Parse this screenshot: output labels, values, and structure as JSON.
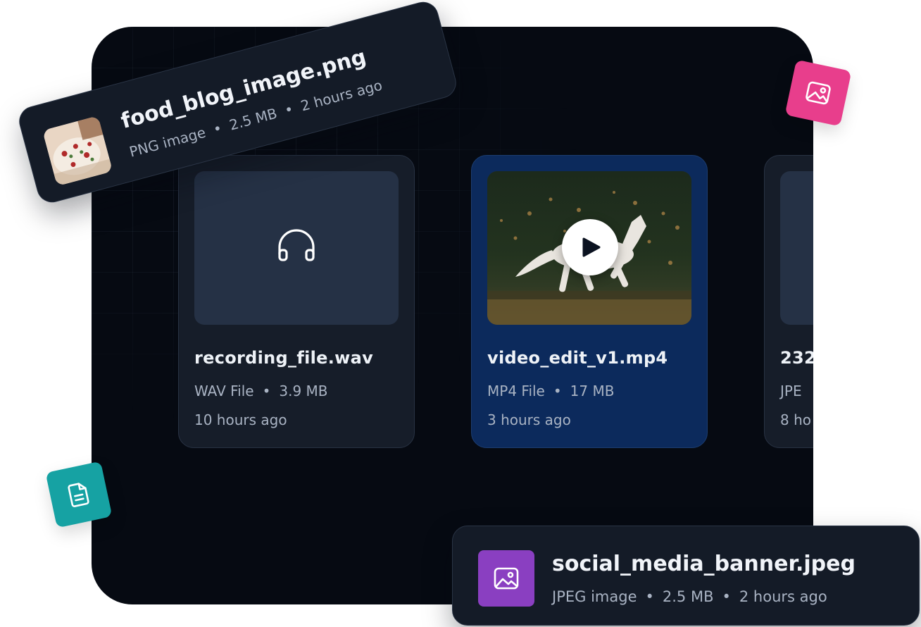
{
  "cards": [
    {
      "title": "recording_file.wav",
      "type": "WAV File",
      "size": "3.9 MB",
      "time": "10 hours ago",
      "icon": "headphones-icon"
    },
    {
      "title": "video_edit_v1.mp4",
      "type": "MP4 File",
      "size": "17 MB",
      "time": "3 hours ago",
      "icon": "play-icon"
    },
    {
      "title": "232",
      "type": "JPE",
      "time": "8 ho"
    }
  ],
  "chips": {
    "food": {
      "title": "food_blog_image.png",
      "type": "PNG image",
      "size": "2.5 MB",
      "time": "2 hours ago"
    },
    "social": {
      "title": "social_media_banner.jpeg",
      "type": "JPEG image",
      "size": "2.5 MB",
      "time": "2 hours ago",
      "icon": "image-icon"
    }
  },
  "separator": "•",
  "colors": {
    "panel": "#060a12",
    "card": "#161d29",
    "card_active": "#0c2a5c",
    "pink_tile": "#e83e8c",
    "teal_tile": "#16a2a3",
    "purple_badge": "#8a3fc1"
  },
  "decor": {
    "pink_tile_icon": "image-icon",
    "teal_tile_icon": "document-icon"
  }
}
